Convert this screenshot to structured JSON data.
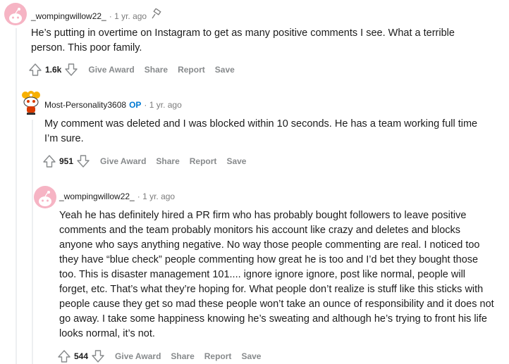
{
  "comments": [
    {
      "username": "_wompingwillow22_",
      "op_badge": "",
      "time": "· 1 yr. ago",
      "text": "He’s putting in overtime on Instagram to get as many positive comments I see. What a terrible person. This poor family.",
      "score": "1.6k",
      "actions": [
        "Give Award",
        "Share",
        "Report",
        "Save"
      ],
      "avatar_icon": "reddit-snoo-avatar-icon"
    },
    {
      "username": "Most-Personality3608",
      "op_badge": "OP",
      "time": "· 1 yr. ago",
      "text": "My comment was deleted and I was blocked within 10 seconds. He has a team working full time I’m sure.",
      "score": "951",
      "actions": [
        "Give Award",
        "Share",
        "Report",
        "Save"
      ],
      "avatar_icon": "custom-snoo-avatar-icon"
    },
    {
      "username": "_wompingwillow22_",
      "op_badge": "",
      "time": "· 1 yr. ago",
      "text": "Yeah he has definitely hired a PR firm who has probably bought followers to leave positive comments and the team probably monitors his account like crazy and deletes and blocks anyone who says anything negative. No way those people commenting are real. I noticed too they have “blue check” people commenting how great he is too and I’d bet they bought those too. This is disaster management 101.... ignore ignore ignore, post like normal, people will forget, etc. That’s what they’re hoping for. What people don’t realize is stuff like this sticks with people cause they get so mad these people won’t take an ounce of responsibility and it does not go away. I take some happiness knowing he’s sweating and although he’s trying to front his life looks normal, it’s not.",
      "score": "544",
      "actions": [
        "Give Award",
        "Share",
        "Report",
        "Save"
      ],
      "avatar_icon": "reddit-snoo-avatar-icon"
    }
  ],
  "colors": {
    "op": "#0079d3",
    "meta": "#7c7c7c",
    "action": "#878a8c",
    "avatar_bg": "#f6b4c4"
  }
}
